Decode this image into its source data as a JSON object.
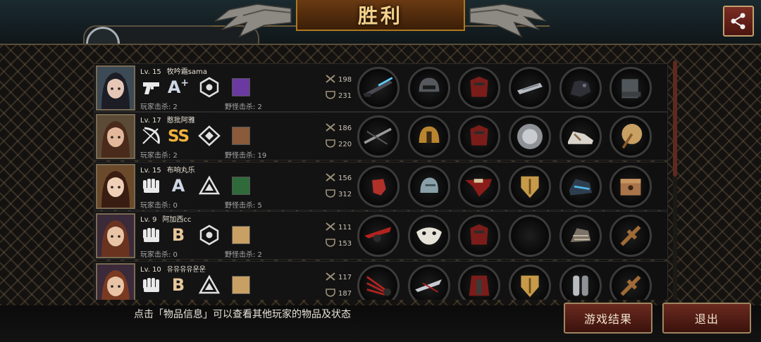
{
  "header": {
    "title": "胜利",
    "share_icon": "share-icon"
  },
  "players": [
    {
      "level": "Lv. 15",
      "name": "牧吟霜sama",
      "class_icon": "pistol-icon",
      "grade": "A",
      "grade_plus": "+",
      "role_icon": "hexagon-rank-icon",
      "player_kills": "玩家击杀: 2",
      "monster_kills": "野怪击杀: 2",
      "attack": "198",
      "defense": "231",
      "items": [
        "rifle",
        "helmet-dark",
        "red-armor",
        "silver-gauntlet",
        "dark-glove",
        "metal-boots"
      ]
    },
    {
      "level": "Lv. 17",
      "name": "憨批阿雅",
      "class_icon": "bow-icon",
      "grade": "SS",
      "grade_plus": "",
      "role_icon": "diamond-rank-icon",
      "player_kills": "玩家击杀: 2",
      "monster_kills": "野怪击杀: 19",
      "attack": "186",
      "defense": "220",
      "items": [
        "crossbow",
        "golden-helmet",
        "red-armor",
        "silver-disc",
        "sneaker",
        "golden-fan"
      ]
    },
    {
      "level": "Lv. 15",
      "name": "布响丸乐",
      "class_icon": "fist-icon",
      "grade": "A",
      "grade_plus": "",
      "role_icon": "triangle-rank-icon",
      "player_kills": "玩家击杀: 0",
      "monster_kills": "野怪击杀: 5",
      "attack": "156",
      "defense": "312",
      "items": [
        "red-fist",
        "steel-helmet",
        "red-cape",
        "golden-shield",
        "blue-boots",
        "treasure-box"
      ]
    },
    {
      "level": "Lv. 9",
      "name": "阿加西cc",
      "class_icon": "fist-icon",
      "grade": "B",
      "grade_plus": "",
      "role_icon": "hexagon-rank-icon",
      "player_kills": "玩家击杀: 0",
      "monster_kills": "野怪击杀: 2",
      "attack": "111",
      "defense": "153",
      "items": [
        "red-blades",
        "white-mask",
        "red-armor",
        "empty",
        "bandaged-arm",
        "wooden-cross"
      ]
    },
    {
      "level": "Lv. 10",
      "name": "유유유유운운",
      "class_icon": "fist-icon",
      "grade": "B",
      "grade_plus": "",
      "role_icon": "triangle-rank-icon",
      "player_kills": "",
      "monster_kills": "",
      "attack": "117",
      "defense": "187",
      "items": [
        "red-claw",
        "silver-blades",
        "red-coat",
        "golden-shield",
        "steel-greaves",
        "wooden-cross"
      ]
    }
  ],
  "footer": {
    "hint": "点击「物品信息」可以查看其他玩家的物品及状态",
    "results_button": "游戏结果",
    "exit_button": "退出"
  },
  "colors": {
    "accent_gold": "#f3d18a",
    "button_red": "#6b2a1f",
    "ss_grade": "#f0b23c"
  }
}
